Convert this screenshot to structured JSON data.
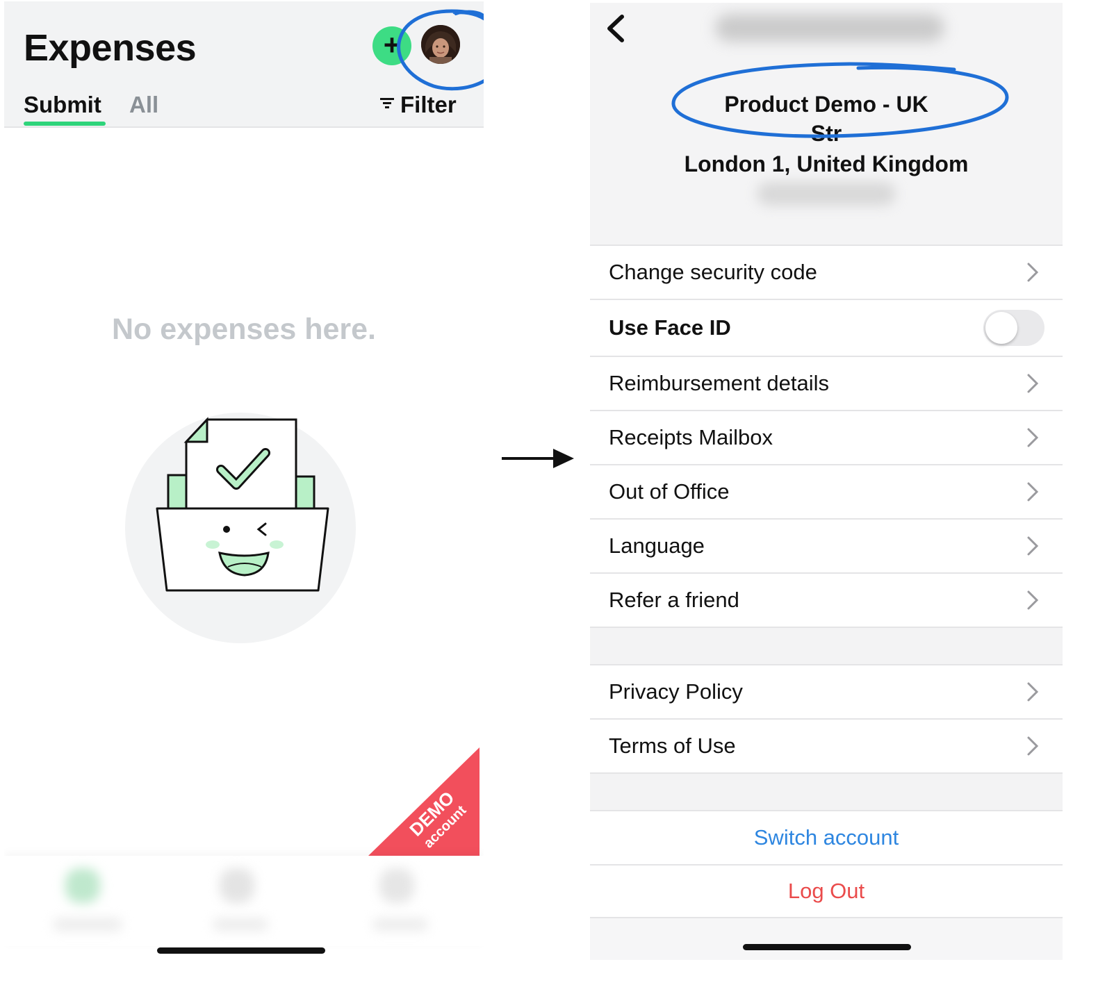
{
  "left": {
    "title": "Expenses",
    "add_icon": "plus-icon",
    "tabs": [
      {
        "label": "Submit",
        "active": true
      },
      {
        "label": "All",
        "active": false
      }
    ],
    "filter_label": "Filter",
    "empty_message": "No expenses here.",
    "demo_ribbon": {
      "line1": "DEMO",
      "line2": "account"
    },
    "colors": {
      "accent": "#2ed47a",
      "ribbon": "#f24f5c",
      "empty_text": "#c4c8cc"
    }
  },
  "right": {
    "company_lines": [
      "Product Demo - UK",
      "Str",
      "London 1, United Kingdom"
    ],
    "settings": [
      {
        "label": "Change security code",
        "type": "link"
      },
      {
        "label": "Use Face ID",
        "type": "toggle",
        "on": false
      },
      {
        "label": "Reimbursement details",
        "type": "link"
      },
      {
        "label": "Receipts Mailbox",
        "type": "link"
      },
      {
        "label": "Out of Office",
        "type": "link"
      },
      {
        "label": "Language",
        "type": "link"
      },
      {
        "label": "Refer a friend",
        "type": "link"
      }
    ],
    "legal": [
      {
        "label": "Privacy Policy"
      },
      {
        "label": "Terms of Use"
      }
    ],
    "switch_account": "Switch account",
    "log_out": "Log Out",
    "colors": {
      "link": "#2e86e0",
      "danger": "#ea4b4b",
      "annotation": "#1f6fd6"
    }
  }
}
